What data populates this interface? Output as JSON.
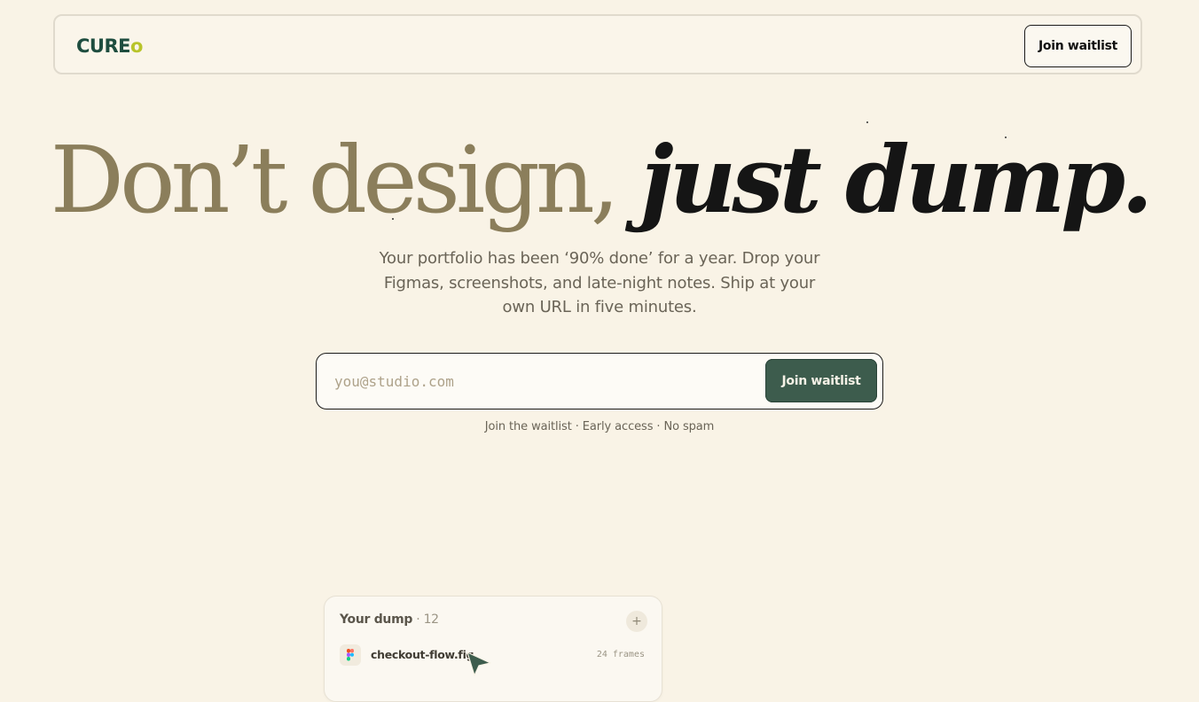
{
  "brand": {
    "logo_main": "CURE",
    "logo_accent": "o"
  },
  "nav": {
    "cta_label": "Join waitlist"
  },
  "hero": {
    "headline_plain": "Don’t design, ",
    "headline_italic": "just dump.",
    "subtitle": "Your portfolio has been ‘90% done’ for a year. Drop your Figmas, screenshots, and late-night notes. Ship at your own URL in five minutes."
  },
  "waitlist_form": {
    "email_placeholder": "you@studio.com",
    "submit_label": "Join waitlist",
    "note": "Join the waitlist · Early access · No spam"
  },
  "dump_card": {
    "title": "Your dump",
    "separator": " · ",
    "count": "12",
    "add_icon": "plus-icon",
    "items": [
      {
        "name": "checkout-flow.fig",
        "meta": "24 frames",
        "icon": "figma-icon"
      }
    ]
  },
  "colors": {
    "background": "#f9f3e6",
    "brand_green": "#1e4d3f",
    "logo_accent": "#b8c42a",
    "headline_muted": "#8b7e5b",
    "headline_dark": "#151515",
    "primary_button": "#3d5c4d",
    "body_text": "#6a6457"
  }
}
